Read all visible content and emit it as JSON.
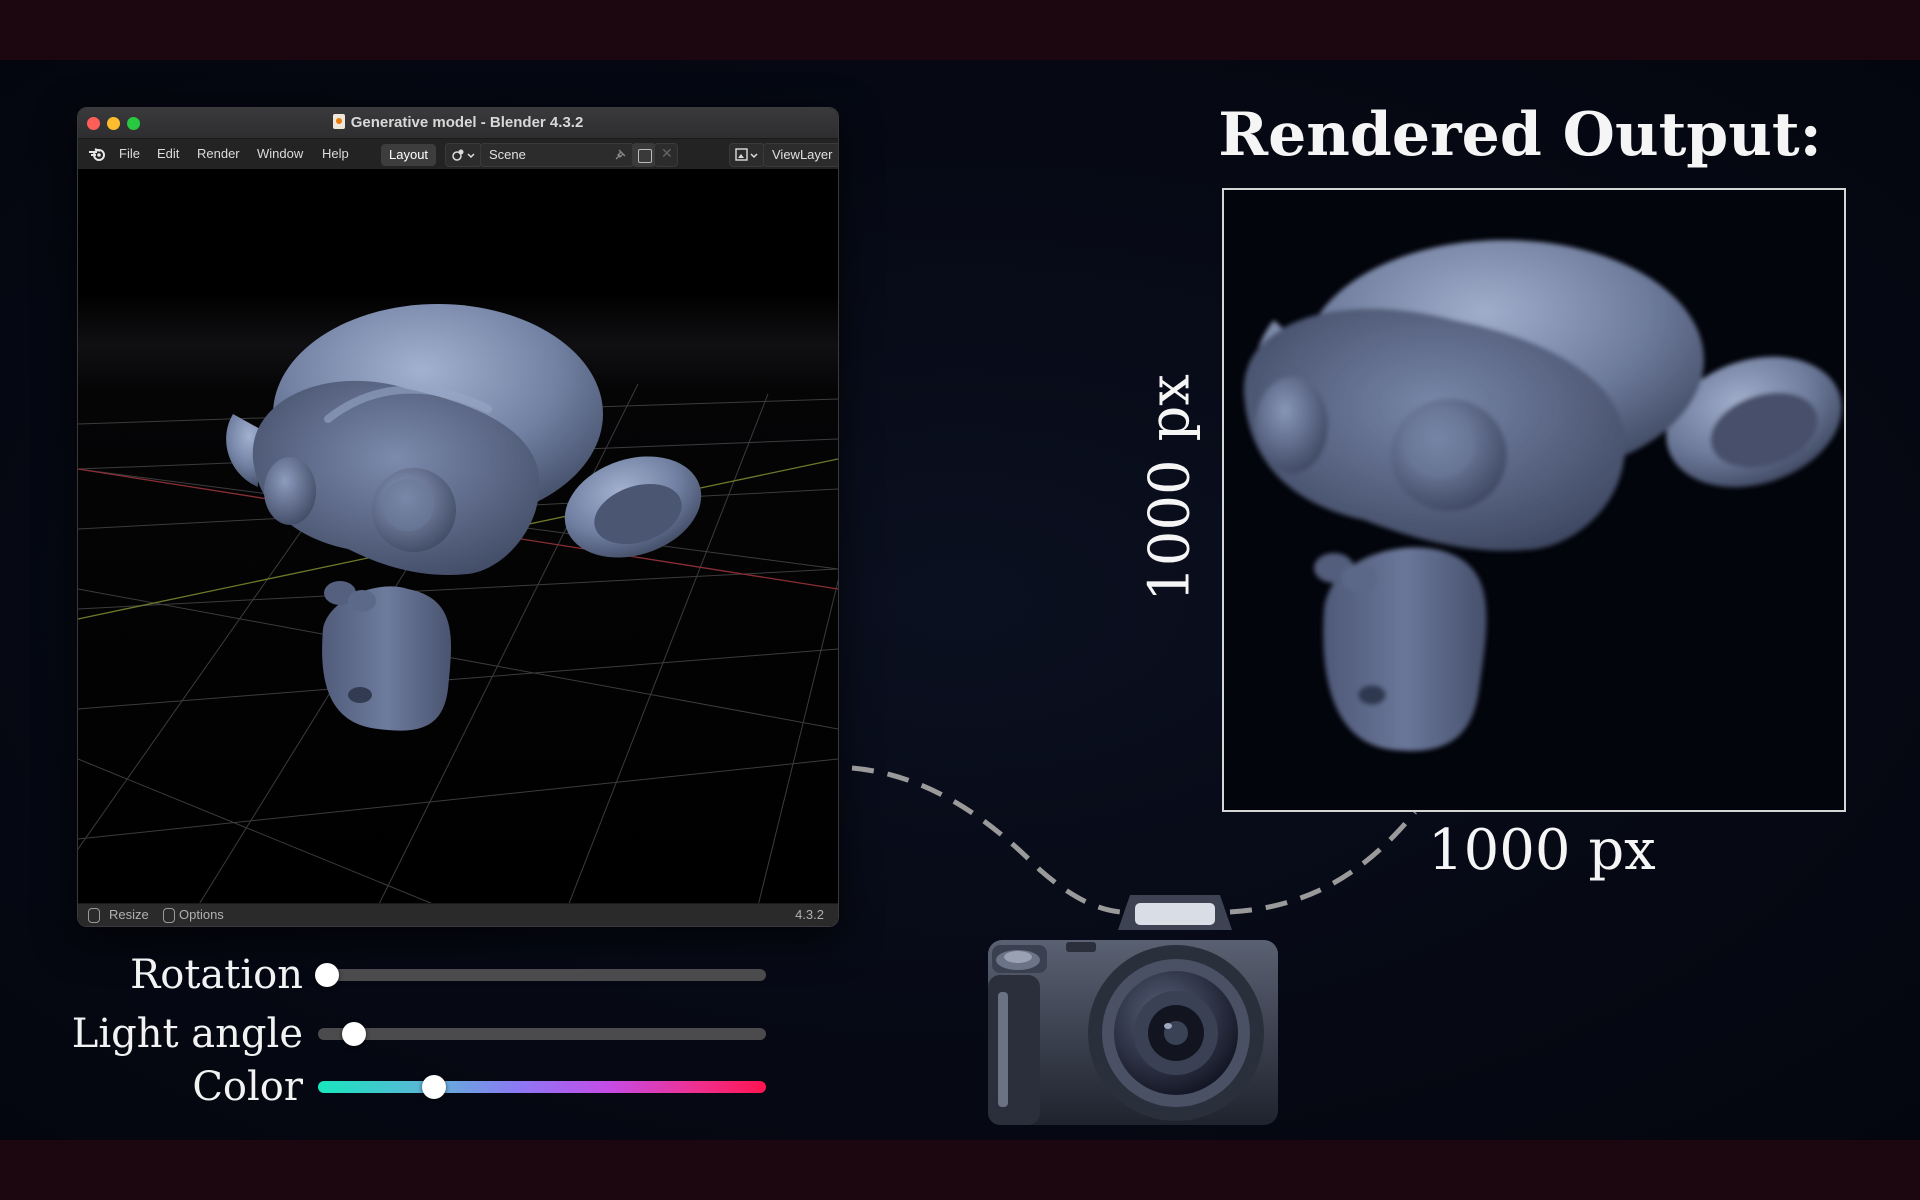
{
  "window": {
    "title": "Generative model - Blender 4.3.2",
    "menu": [
      "File",
      "Edit",
      "Render",
      "Window",
      "Help"
    ],
    "workspace_tab": "Layout",
    "scene_label": "Scene",
    "view_layer_label": "ViewLayer",
    "status": {
      "resize": "Resize",
      "options": "Options",
      "version": "4.3.2"
    }
  },
  "controls": [
    {
      "label": "Rotation",
      "value": 0.02,
      "style": "gray"
    },
    {
      "label": "Light angle",
      "value": 0.08,
      "style": "gray"
    },
    {
      "label": "Color",
      "value": 0.26,
      "style": "gradient"
    }
  ],
  "output": {
    "title": "Rendered Output:",
    "width_label": "1000 px",
    "height_label": "1000 px"
  },
  "icons": [
    "blender-logo-icon",
    "document-icon",
    "pin-icon",
    "copy-icon",
    "close-icon",
    "scene-icon",
    "viewlayer-icon",
    "mouse-icon",
    "camera-icon"
  ],
  "colors": {
    "mesh": "#6f7e9e",
    "background": "#050813",
    "band": "#1c060f",
    "gradient_start": "#18e6be",
    "gradient_end": "#ff1450"
  }
}
